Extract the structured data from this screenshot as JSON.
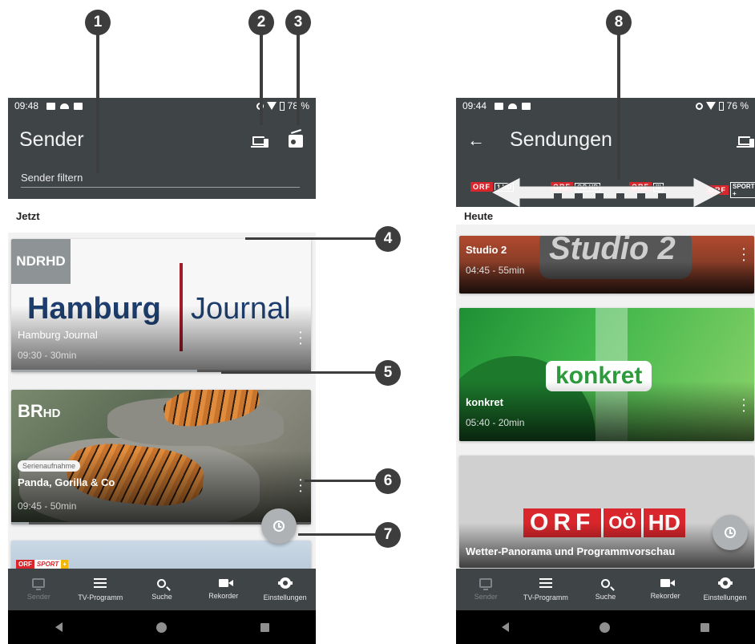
{
  "callouts": [
    "1",
    "2",
    "3",
    "4",
    "5",
    "6",
    "7",
    "8"
  ],
  "left_screen": {
    "status_time": "09:48",
    "status_battery": "78 %",
    "title": "Sender",
    "filter_placeholder": "Sender filtern",
    "section": "Jetzt",
    "cards": [
      {
        "channel_logo": "NDRHD",
        "art_text_1": "Hamburg",
        "art_text_2": "Journal",
        "title": "Hamburg Journal",
        "meta": "09:30 - 30min",
        "progress": 0.62
      },
      {
        "channel_logo": "BR",
        "channel_logo_suffix": "HD",
        "chip": "Serienaufnahme",
        "title": "Panda, Gorilla & Co",
        "meta": "09:45 - 50min",
        "progress": 0.06
      },
      {
        "logo_orf": "ORF",
        "logo_sport": "SPORT",
        "logo_plus": "+"
      }
    ]
  },
  "right_screen": {
    "status_time": "09:44",
    "status_battery": "76 %",
    "title": "Sendungen",
    "channel_strip": [
      {
        "orf": "ORF",
        "sub": "1 HD"
      },
      {
        "orf": "ORF",
        "sub": "OÖ HD"
      },
      {
        "orf": "ORF",
        "sub": "III"
      },
      {
        "orf": "ORF",
        "sub": "SPORT +"
      }
    ],
    "section": "Heute",
    "cards": [
      {
        "art_text": "Studio 2",
        "title": "Studio 2",
        "meta": "04:45 - 55min"
      },
      {
        "art_text": "konkret",
        "title": "konkret",
        "meta": "05:40 - 20min"
      },
      {
        "art_orf": "ORF",
        "art_region": "OÖ",
        "art_hd": "HD",
        "title": "Wetter-Panorama und Programmvorschau"
      }
    ]
  },
  "bottom_nav": [
    {
      "label": "Sender",
      "icon": "tv-icon",
      "active": true
    },
    {
      "label": "TV-Programm",
      "icon": "list-icon",
      "active": false
    },
    {
      "label": "Suche",
      "icon": "search-icon",
      "active": false
    },
    {
      "label": "Rekorder",
      "icon": "camera-icon",
      "active": false
    },
    {
      "label": "Einstellungen",
      "icon": "gear-icon",
      "active": false
    }
  ],
  "colors": {
    "app_bar": "#3f4447",
    "callout": "#3d3d3d",
    "orf_red": "#d9262c",
    "fab": "#aeb2b4"
  }
}
